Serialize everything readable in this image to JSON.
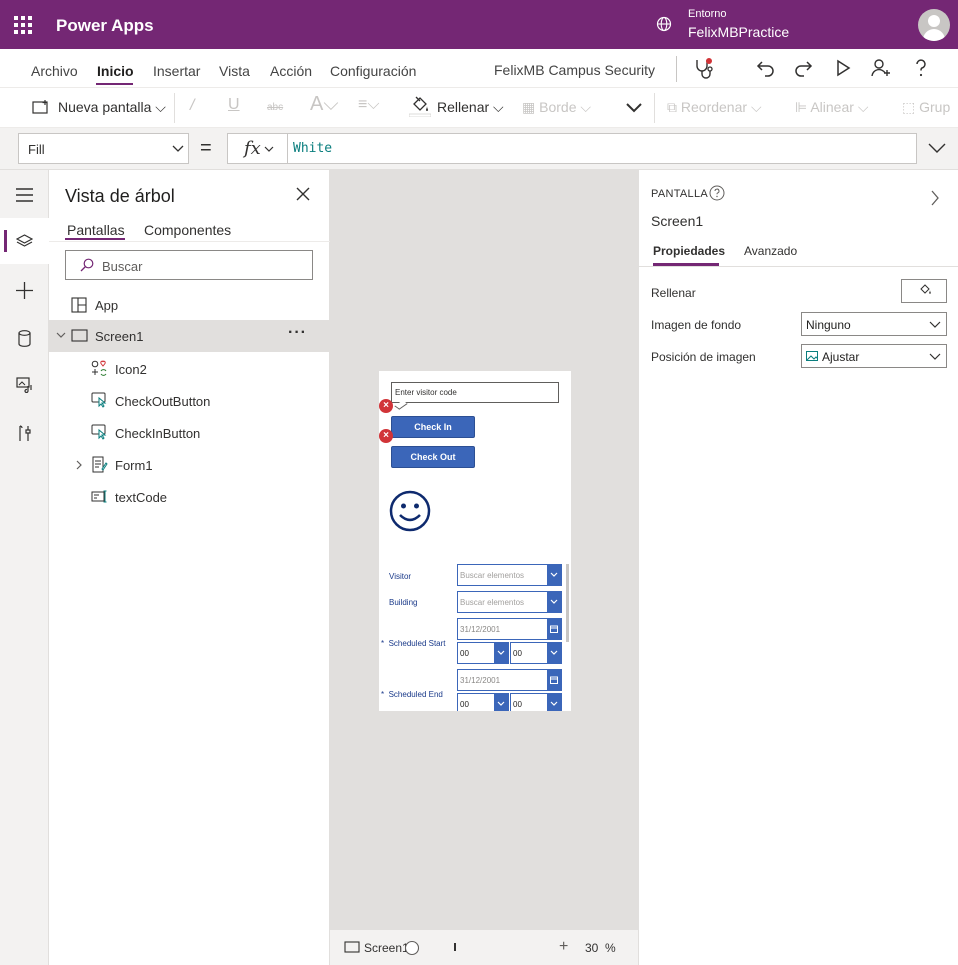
{
  "header": {
    "app_name": "Power Apps",
    "env_label": "Entorno",
    "env_name": "FelixMBPractice"
  },
  "menu": {
    "items": [
      "Archivo",
      "Inicio",
      "Insertar",
      "Vista",
      "Acción",
      "Configuración"
    ],
    "active": "Inicio",
    "app_file": "FelixMB Campus Security"
  },
  "ribbon": {
    "new_screen": "Nueva pantalla",
    "fill": "Rellenar",
    "border": "Borde",
    "reorder": "Reordenar",
    "align": "Alinear",
    "group": "Grup"
  },
  "formula": {
    "property": "Fill",
    "equals": "=",
    "fx": "fx",
    "value": "White"
  },
  "tree": {
    "title": "Vista de árbol",
    "tabs": [
      "Pantallas",
      "Componentes"
    ],
    "search_placeholder": "Buscar",
    "items": [
      {
        "label": "App",
        "icon": "app-icon"
      },
      {
        "label": "Screen1",
        "icon": "screen-icon"
      },
      {
        "label": "Icon2",
        "icon": "icons-icon"
      },
      {
        "label": "CheckOutButton",
        "icon": "button-icon"
      },
      {
        "label": "CheckInButton",
        "icon": "button-icon"
      },
      {
        "label": "Form1",
        "icon": "form-icon"
      },
      {
        "label": "textCode",
        "icon": "textinput-icon"
      }
    ],
    "more": "···"
  },
  "phone": {
    "input_placeholder": "Enter visitor code",
    "check_in": "Check In",
    "check_out": "Check Out",
    "visitor_label": "Visitor",
    "building_label": "Building",
    "search_items": "Buscar elementos",
    "scheduled_start": "Scheduled Start",
    "scheduled_end": "Scheduled End",
    "date": "31/12/2001",
    "hour": "00",
    "minute": "00",
    "required": "*"
  },
  "bottom": {
    "screen": "Screen1",
    "zoom": "30",
    "zoom_unit": "%",
    "plus": "+"
  },
  "properties": {
    "kind": "PANTALLA",
    "name": "Screen1",
    "tabs": [
      "Propiedades",
      "Avanzado"
    ],
    "fill_label": "Rellenar",
    "bg_image_label": "Imagen de fondo",
    "bg_image_value": "Ninguno",
    "image_pos_label": "Posición de imagen",
    "image_pos_value": "Ajustar"
  },
  "colors": {
    "brand": "#742774",
    "button": "#3b66b9",
    "error": "#d13438"
  }
}
